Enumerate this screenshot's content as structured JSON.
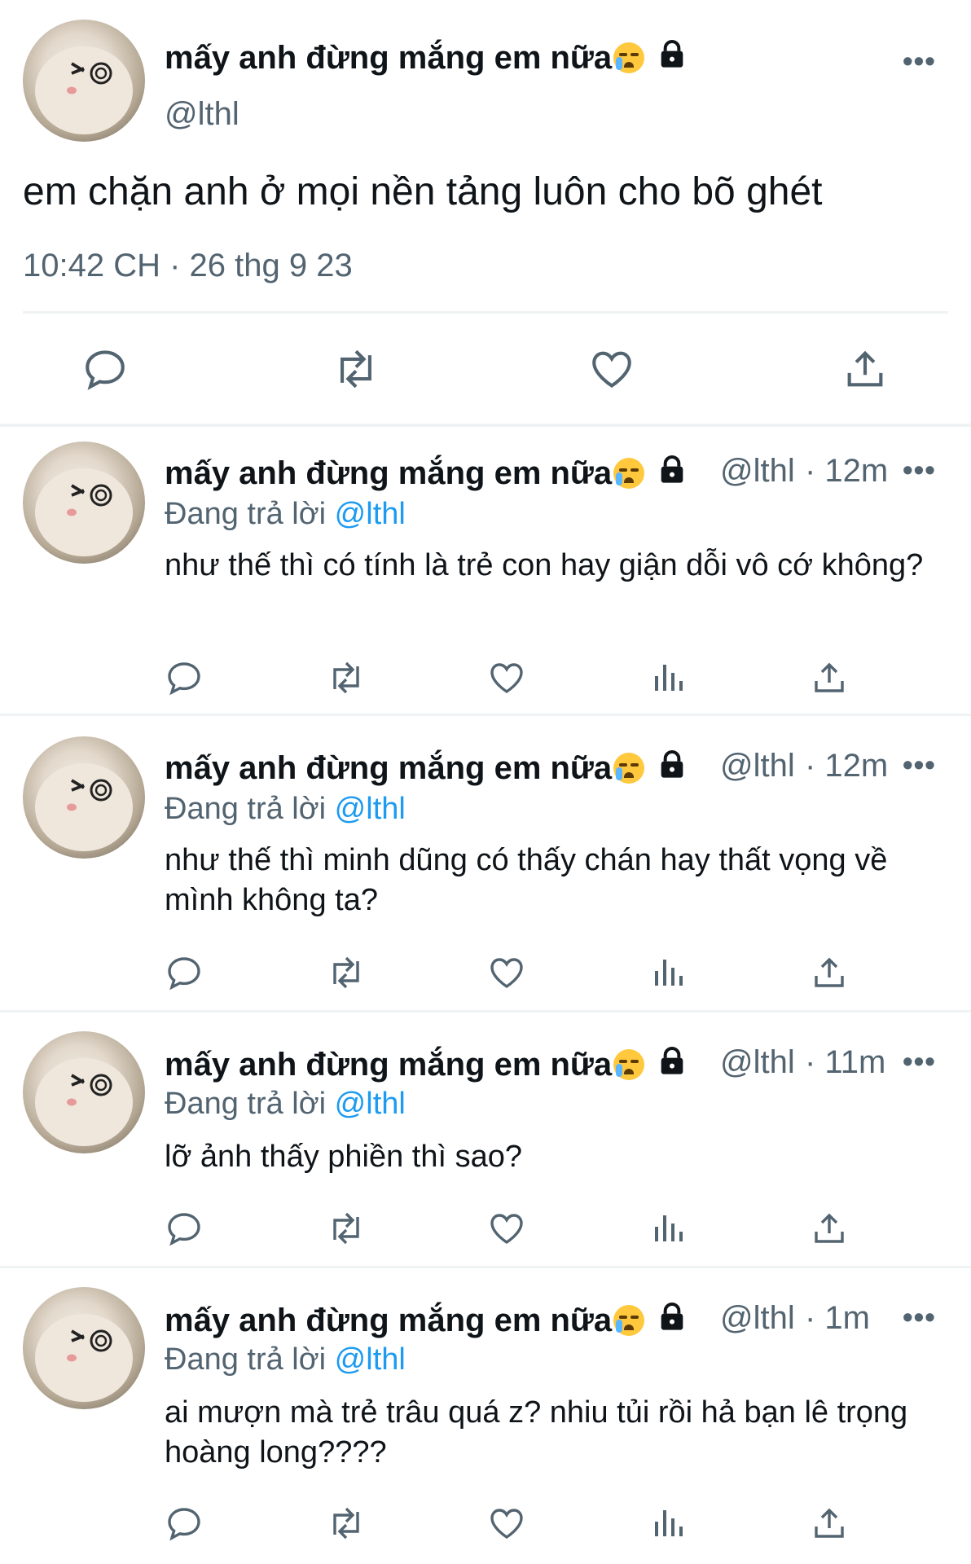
{
  "main_tweet": {
    "display_name": "mấy anh đừng mắng em nữa",
    "handle": "@lthl",
    "text": "em chặn anh ở mọi nền tảng luôn cho bõ ghét",
    "timestamp": "10:42 CH · 26 thg 9 23",
    "actions": [
      "reply-icon",
      "retweet-icon",
      "like-icon",
      "share-icon"
    ]
  },
  "replies": [
    {
      "display_name": "mấy anh đừng mắng em nữa",
      "handle": "@lthl",
      "time": "· 12m",
      "replying_prefix": "Đang trả lời ",
      "replying_to": "@lthl",
      "text": "như thế thì có tính là trẻ con hay giận dỗi vô cớ không?"
    },
    {
      "display_name": "mấy anh đừng mắng em nữa",
      "handle": "@lthl",
      "time": "· 12m",
      "replying_prefix": "Đang trả lời ",
      "replying_to": "@lthl",
      "text": "như thế thì minh dũng có thấy chán hay thất vọng về mình không ta?"
    },
    {
      "display_name": "mấy anh đừng mắng em nữa",
      "handle": "@lthl",
      "time": "· 11m",
      "replying_prefix": "Đang trả lời ",
      "replying_to": "@lthl",
      "text": "lỡ ảnh thấy phiền thì sao?"
    },
    {
      "display_name": "mấy anh đừng mắng em nữa",
      "handle": "@lthl",
      "time": "· 1m",
      "replying_prefix": "Đang trả lời ",
      "replying_to": "@lthl",
      "text": "ai mượn mà trẻ trâu quá z? nhiu tủi rồi hả bạn lê trọng hoàng long????"
    }
  ],
  "more_label": "•••",
  "colors": {
    "link": "#1d9bf0",
    "secondary": "#536471",
    "divider": "#eff3f4"
  }
}
